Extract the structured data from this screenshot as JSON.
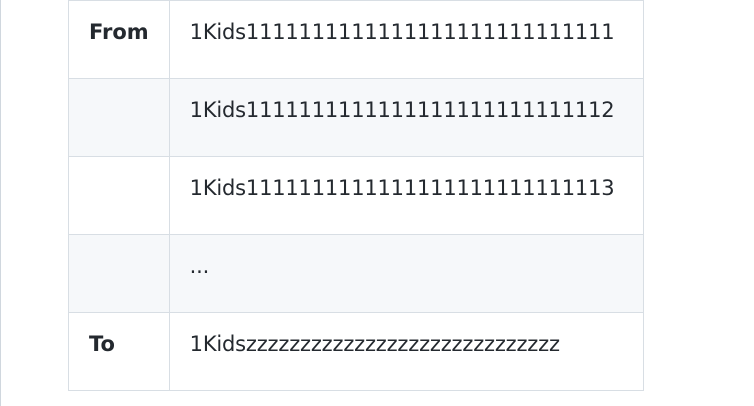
{
  "table": {
    "rows": [
      {
        "label": "From",
        "value": "1Kids1111111111111111111111111111"
      },
      {
        "label": "",
        "value": "1Kids1111111111111111111111111112"
      },
      {
        "label": "",
        "value": "1Kids1111111111111111111111111113"
      },
      {
        "label": "",
        "value": "..."
      },
      {
        "label": "To",
        "value": "1Kidszzzzzzzzzzzzzzzzzzzzzzzzzzzzz"
      }
    ]
  }
}
